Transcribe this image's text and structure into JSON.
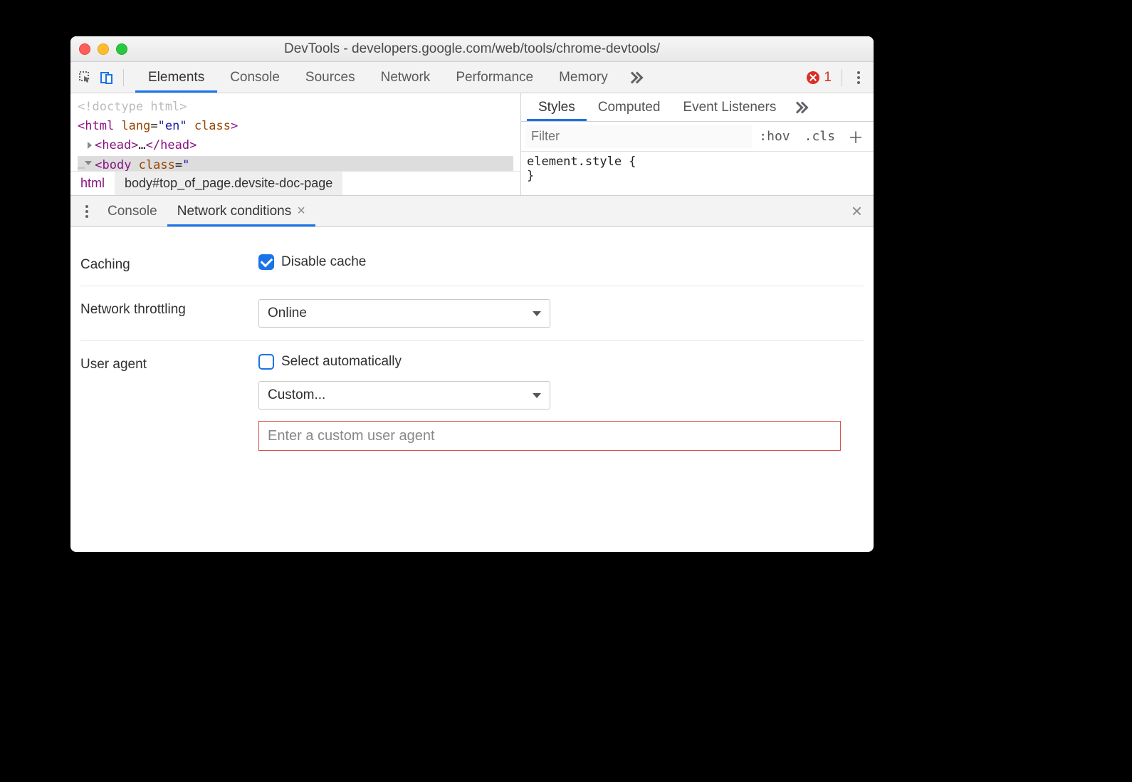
{
  "window": {
    "title": "DevTools - developers.google.com/web/tools/chrome-devtools/"
  },
  "toolbar": {
    "tabs": [
      "Elements",
      "Console",
      "Sources",
      "Network",
      "Performance",
      "Memory"
    ],
    "active_tab": "Elements",
    "error_count": "1"
  },
  "dom": {
    "line1": "<!doctype html>",
    "line2_open": "<html",
    "line2_attr": " lang",
    "line2_eq": "=",
    "line2_val": "\"en\"",
    "line2_attr2": " class",
    "line2_close": ">",
    "line3_open": "<head>",
    "line3_dots": "…",
    "line3_close": "</head>",
    "line4_open": "<body",
    "line4_attr": " class",
    "line4_eq": "=",
    "line4_val": "\"",
    "line4_pre": "…",
    "crumb_root": "html",
    "crumb_sel": "body#top_of_page.devsite-doc-page"
  },
  "styles": {
    "tabs": [
      "Styles",
      "Computed",
      "Event Listeners"
    ],
    "active": "Styles",
    "filter_placeholder": "Filter",
    "hov": ":hov",
    "cls": ".cls",
    "code_line1": "element.style {",
    "code_line2": "}"
  },
  "drawer": {
    "tab1": "Console",
    "tab2": "Network conditions",
    "active": "Network conditions"
  },
  "form": {
    "caching_label": "Caching",
    "caching_checkbox": "Disable cache",
    "caching_checked": true,
    "throttling_label": "Network throttling",
    "throttling_value": "Online",
    "ua_label": "User agent",
    "ua_checkbox": "Select automatically",
    "ua_checked": false,
    "ua_select": "Custom...",
    "ua_placeholder": "Enter a custom user agent"
  }
}
